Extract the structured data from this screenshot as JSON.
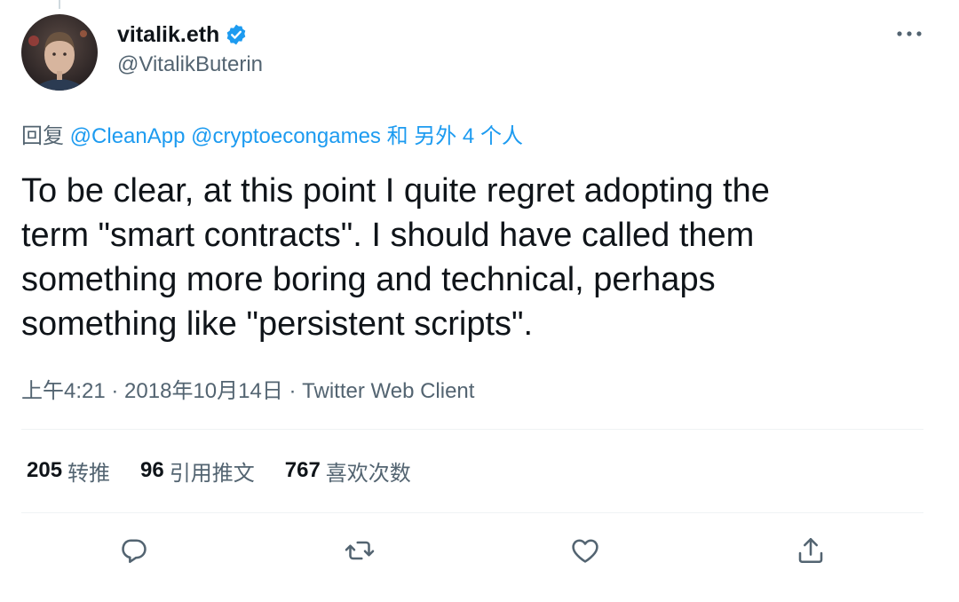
{
  "author": {
    "display_name": "vitalik.eth",
    "handle": "@VitalikButerin",
    "verified": true
  },
  "reply_to": {
    "prefix": "回复",
    "mentions": [
      "@CleanApp",
      "@cryptoecongames"
    ],
    "suffix": "和 另外 4 个人"
  },
  "tweet": {
    "text": "To be clear, at this point I quite regret adopting the\nterm \"smart contracts\". I should have called them\nsomething more boring and technical, perhaps\nsomething like \"persistent scripts\"."
  },
  "meta": {
    "time": "上午4:21",
    "separator": " · ",
    "date": "2018年10月14日",
    "source": "Twitter Web Client"
  },
  "stats": {
    "retweets_count": "205",
    "retweets_label": "转推",
    "quotes_count": "96",
    "quotes_label": "引用推文",
    "likes_count": "767",
    "likes_label": "喜欢次数"
  },
  "icons": {
    "more": "more-horizontal-icon",
    "reply": "reply-icon",
    "retweet": "retweet-icon",
    "like": "heart-icon",
    "share": "share-icon"
  },
  "colors": {
    "accent": "#1d9bf0",
    "secondary_text": "#536471",
    "primary_text": "#0f1419"
  }
}
